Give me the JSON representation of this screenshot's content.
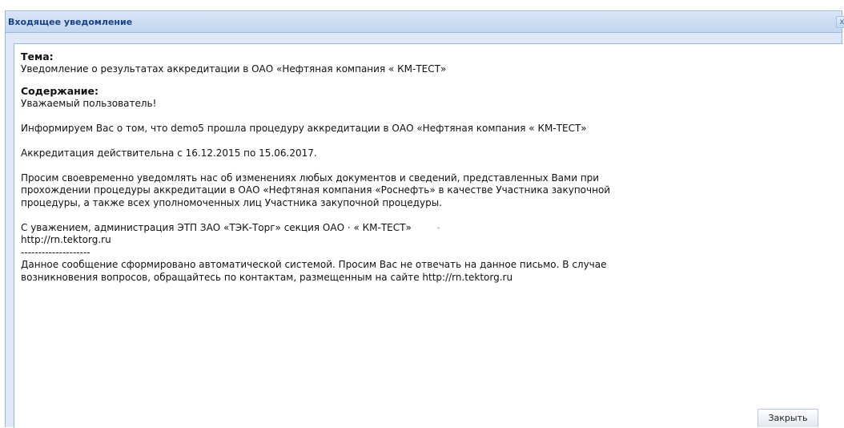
{
  "window": {
    "title": "Входящее уведомление"
  },
  "message": {
    "subject_label": "Тема:",
    "subject": "Уведомление о результатах аккредитации в ОАО «Нефтяная компания « КМ-ТЕСТ»",
    "content_label": "Содержание:",
    "greeting": "Уважаемый пользователь!",
    "info": "Информируем Вас о том, что demo5 прошла процедуру аккредитации в ОАО «Нефтяная компания « КМ-ТЕСТ»",
    "validity": "Аккредитация действительна с 16.12.2015 по 15.06.2017.",
    "request_lines": [
      "Просим своевременно уведомлять нас об изменениях любых документов и сведений, представленных Вами при",
      "прохождении процедуры аккредитации в ОАО «Нефтяная компания «Роснефть» в качестве Участника закупочной",
      "процедуры, а также всех уполномоченных лиц Участника закупочной процедуры."
    ],
    "signature": "С уважением, администрация ЭТП ЗАО «ТЭК-Торг» секция ОАО · « КМ-ТЕСТ»",
    "site": "http://rn.tektorg.ru",
    "separator": "--------------------",
    "auto_lines": [
      "Данное сообщение сформировано автоматической системой. Просим Вас не отвечать на данное письмо. В случае",
      "возникновения вопросов, обращайтесь по контактам, размещенным на сайте http://rn.tektorg.ru"
    ]
  },
  "buttons": {
    "close_label": "Закрыть",
    "close_tool_glyph": "x"
  },
  "icons": {
    "close_tool": "close-icon"
  },
  "colors": {
    "title_text": "#15428b",
    "border": "#99bbe8",
    "header_bg": "#cddef3"
  }
}
